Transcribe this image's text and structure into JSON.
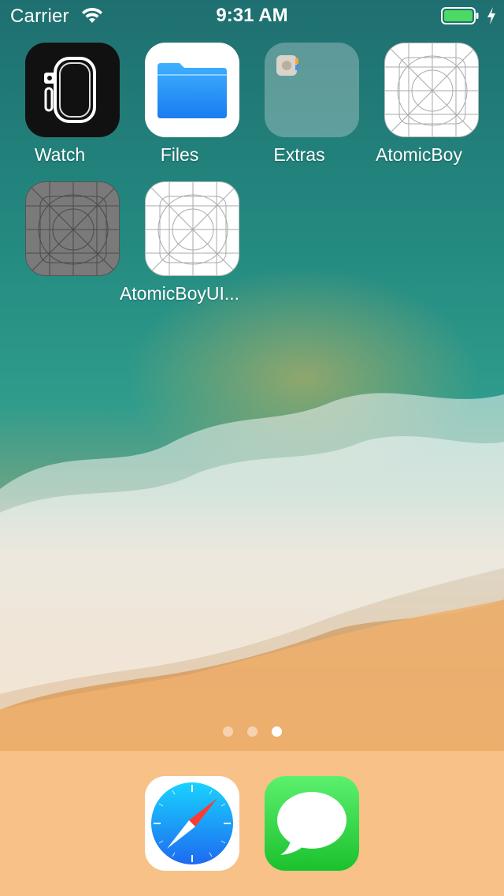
{
  "status_bar": {
    "carrier": "Carrier",
    "time": "9:31 AM",
    "wifi_icon": "wifi-icon",
    "battery_icon": "battery-icon",
    "battery_level": 1.0,
    "charging_icon": "charging-bolt-icon",
    "battery_color": "#4cd964"
  },
  "home_screen": {
    "apps": [
      {
        "label": "Watch",
        "icon": "watch-app-icon"
      },
      {
        "label": "Files",
        "icon": "files-app-icon"
      },
      {
        "label": "Extras",
        "icon": "folder-icon"
      },
      {
        "label": "AtomicBoy",
        "icon": "placeholder-app-icon"
      },
      {
        "label": "",
        "icon": "placeholder-app-icon-dimmed"
      },
      {
        "label": "AtomicBoyUI...",
        "icon": "placeholder-app-icon"
      }
    ],
    "page_indicator": {
      "pages": 3,
      "current": 3
    }
  },
  "dock": {
    "apps": [
      {
        "name": "Safari",
        "icon": "safari-compass-icon",
        "color": "#1e90ff"
      },
      {
        "name": "Messages",
        "icon": "messages-bubble-icon",
        "color": "#34c759"
      }
    ]
  }
}
